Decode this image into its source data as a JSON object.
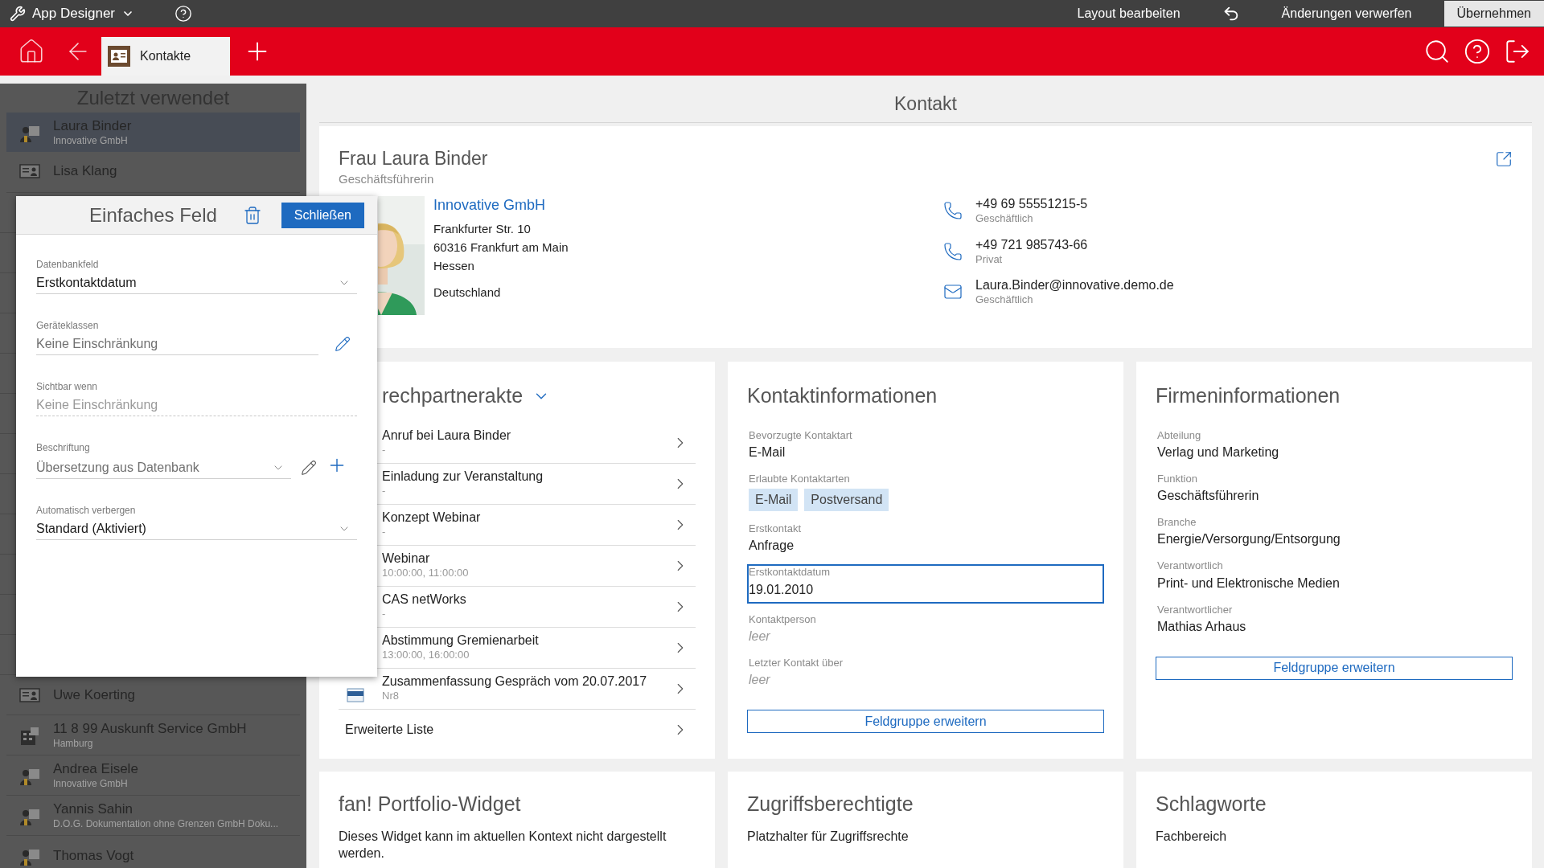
{
  "app_bar": {
    "title": "App Designer",
    "actions": [
      {
        "kind": "text",
        "label": "Layout bearbeiten"
      },
      {
        "kind": "undo"
      },
      {
        "kind": "text",
        "label": "Änderungen verwerfen"
      },
      {
        "kind": "primary",
        "label": "Übernehmen"
      }
    ]
  },
  "nav": {
    "tabs": [
      {
        "label": "Kontakte",
        "selected": true
      }
    ]
  },
  "sidebar": {
    "title": "Zuletzt verwendet",
    "items": [
      {
        "name": "Laura Binder",
        "subtitle": "Innovative GmbH",
        "kind": "person",
        "selected": true
      },
      {
        "name": "Lisa Klang",
        "kind": "contact",
        "selected": false
      },
      {
        "kind": "hidden"
      },
      {
        "kind": "hidden"
      },
      {
        "kind": "hidden"
      },
      {
        "kind": "hidden"
      },
      {
        "kind": "hidden"
      },
      {
        "kind": "hidden"
      },
      {
        "kind": "hidden"
      },
      {
        "kind": "hidden"
      },
      {
        "kind": "hidden"
      },
      {
        "kind": "hidden"
      },
      {
        "kind": "hidden"
      },
      {
        "kind": "hidden"
      },
      {
        "name": "Uwe Koerting",
        "kind": "contact",
        "selected": false
      },
      {
        "name": "11 8 99 Auskunft Service GmbH",
        "subtitle": "Hamburg",
        "kind": "company",
        "selected": false
      },
      {
        "name": "Andrea Eisele",
        "subtitle": "Innovative GmbH",
        "kind": "person",
        "selected": false
      },
      {
        "name": "Yannis Sahin",
        "subtitle": "D.O.G. Dokumentation ohne Grenzen GmbH Doku...",
        "kind": "person",
        "selected": false
      },
      {
        "name": "Thomas Vogt",
        "kind": "person",
        "selected": false
      }
    ]
  },
  "field_editor": {
    "title": "Einfaches Feld",
    "close_button": "Schließen",
    "fields": [
      {
        "label": "Datenbankfeld",
        "value": "Erstkontaktdatum",
        "kind": "select",
        "dimmed": false
      },
      {
        "label": "Geräteklassen",
        "value": "Keine Einschränkung",
        "kind": "edit",
        "dimmed": true
      },
      {
        "label": "Sichtbar wenn",
        "value": "Keine Einschränkung",
        "kind": "readonly",
        "dimmed": true
      },
      {
        "label": "Beschriftung",
        "value": "Übersetzung aus Datenbank",
        "kind": "select_edit_add",
        "dimmed": true
      },
      {
        "label": "Automatisch verbergen",
        "value": "Standard (Aktiviert)",
        "kind": "select",
        "dimmed": false
      }
    ]
  },
  "page_title": "Kontakt",
  "contact": {
    "name": "Frau Laura Binder",
    "role": "Geschäftsführerin",
    "company": "Innovative GmbH",
    "address": [
      "Frankfurter Str. 10",
      "60316 Frankfurt am Main",
      "Hessen"
    ],
    "country": "Deutschland",
    "communications": [
      {
        "kind": "phone",
        "value": "+49 69 55551215-5",
        "label": "Geschäftlich"
      },
      {
        "kind": "phone",
        "value": "+49 721 985743-66",
        "label": "Privat"
      },
      {
        "kind": "email",
        "value": "Laura.Binder@innovative.demo.de",
        "label": "Geschäftlich"
      }
    ]
  },
  "file_card": {
    "title": "rechpartnerakte",
    "items": [
      {
        "title": "Anruf bei Laura Binder",
        "subtitle": "-",
        "kind": "plain"
      },
      {
        "title": "Einladung zur Veranstaltung",
        "subtitle": "-",
        "kind": "plain"
      },
      {
        "title": "Konzept Webinar",
        "subtitle": "-",
        "kind": "plain"
      },
      {
        "title": "Webinar",
        "subtitle": "10:00:00, 11:00:00",
        "kind": "plain"
      },
      {
        "title": "CAS netWorks",
        "subtitle": "-",
        "kind": "plain"
      },
      {
        "title": "Abstimmung Gremienarbeit",
        "subtitle": "13:00:00, 16:00:00",
        "kind": "plain"
      },
      {
        "title": "Zusammenfassung Gespräch vom 20.07.2017",
        "subtitle": "Nr8",
        "kind": "document"
      }
    ],
    "more_link": "Erweiterte Liste"
  },
  "info_cards": [
    {
      "title": "Kontaktinformationen",
      "fields": [
        {
          "label": "Bevorzugte Kontaktart",
          "kind": "text",
          "value": "E-Mail",
          "selected": false
        },
        {
          "label": "Erlaubte Kontaktarten",
          "kind": "tags",
          "tags": [
            "E-Mail",
            "Postversand"
          ],
          "selected": false
        },
        {
          "label": "Erstkontakt",
          "kind": "text",
          "value": "Anfrage",
          "selected": false
        },
        {
          "label": "Erstkontaktdatum",
          "kind": "text",
          "value": "19.01.2010",
          "selected": true
        },
        {
          "label": "Kontaktperson",
          "kind": "empty",
          "value": "leer",
          "selected": false
        },
        {
          "label": "Letzter Kontakt über",
          "kind": "empty",
          "value": "leer",
          "selected": false
        }
      ],
      "button": "Feldgruppe erweitern"
    },
    {
      "title": "Firmeninformationen",
      "fields": [
        {
          "label": "Abteilung",
          "kind": "text",
          "value": "Verlag und Marketing",
          "selected": false
        },
        {
          "label": "Funktion",
          "kind": "text",
          "value": "Geschäftsführerin",
          "selected": false
        },
        {
          "label": "Branche",
          "kind": "text",
          "value": "Energie/Versorgung/Entsorgung",
          "selected": false
        },
        {
          "label": "Verantwortlich",
          "kind": "text",
          "value": "Print- und Elektronische Medien",
          "selected": false
        },
        {
          "label": "Verantwortlicher",
          "kind": "text",
          "value": "Mathias Arhaus",
          "selected": false
        }
      ],
      "button": "Feldgruppe erweitern"
    }
  ],
  "bottom_cards": [
    {
      "title": "fan! Portfolio-Widget",
      "text": "Dieses Widget kann im aktuellen Kontext nicht dargestellt werden."
    },
    {
      "title": "Zugriffsberechtigte",
      "text": "Platzhalter für Zugriffsrechte"
    },
    {
      "title": "Schlagworte",
      "text": "Fachbereich"
    }
  ]
}
